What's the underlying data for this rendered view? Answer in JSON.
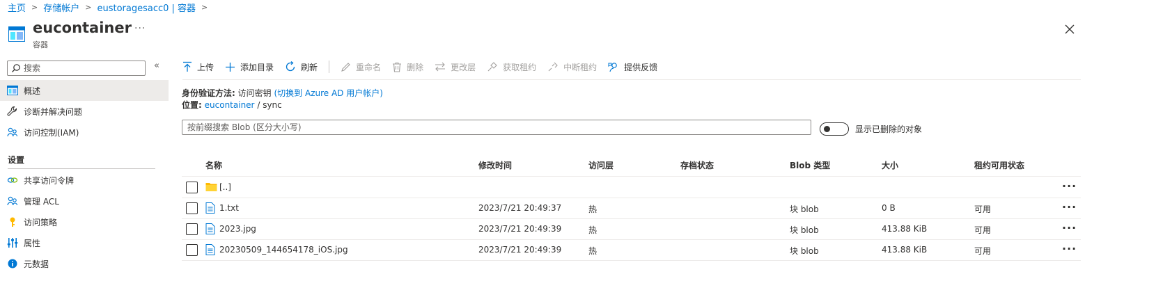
{
  "breadcrumb": [
    "主页",
    "存储帐户",
    "eustoragesacc0 | 容器"
  ],
  "header": {
    "title": "eucontainer",
    "subtitle": "容器",
    "more": "···"
  },
  "sidebar": {
    "search_placeholder": "搜索",
    "collapse_glyph": "«",
    "items": [
      {
        "label": "概述",
        "icon": "container-icon",
        "active": true
      },
      {
        "label": "诊断并解决问题",
        "icon": "wrench-icon"
      },
      {
        "label": "访问控制(IAM)",
        "icon": "people-icon"
      }
    ],
    "section": "设置",
    "settings_items": [
      {
        "label": "共享访问令牌",
        "icon": "link-icon"
      },
      {
        "label": "管理 ACL",
        "icon": "people-icon"
      },
      {
        "label": "访问策略",
        "icon": "key-icon"
      },
      {
        "label": "属性",
        "icon": "sliders-icon"
      },
      {
        "label": "元数据",
        "icon": "info-icon"
      }
    ]
  },
  "toolbar": {
    "upload": "上传",
    "add_directory": "添加目录",
    "refresh": "刷新",
    "rename": "重命名",
    "delete": "删除",
    "change_tier": "更改层",
    "acquire_lease": "获取租约",
    "break_lease": "中断租约",
    "feedback": "提供反馈"
  },
  "auth": {
    "label": "身份验证方法:",
    "value": "访问密钥",
    "switch_link": "(切换到 Azure AD 用户帐户)"
  },
  "location": {
    "label": "位置:",
    "container": "eucontainer",
    "sep": "/",
    "path": "sync"
  },
  "search": {
    "placeholder": "按前缀搜索 Blob (区分大小写)"
  },
  "toggle": {
    "label": "显示已删除的对象"
  },
  "table": {
    "headers": {
      "name": "名称",
      "modified": "修改时间",
      "tier": "访问层",
      "archive": "存档状态",
      "blob_type": "Blob 类型",
      "size": "大小",
      "lease": "租约可用状态"
    },
    "rows": [
      {
        "name": "[..]",
        "icon": "folder-icon",
        "modified": "",
        "tier": "",
        "archive": "",
        "blob_type": "",
        "size": "",
        "lease": ""
      },
      {
        "name": "1.txt",
        "icon": "file-icon",
        "modified": "2023/7/21 20:49:37",
        "tier": "热",
        "archive": "",
        "blob_type": "块 blob",
        "size": "0 B",
        "lease": "可用"
      },
      {
        "name": "2023.jpg",
        "icon": "file-icon",
        "modified": "2023/7/21 20:49:39",
        "tier": "热",
        "archive": "",
        "blob_type": "块 blob",
        "size": "413.88 KiB",
        "lease": "可用"
      },
      {
        "name": "20230509_144654178_iOS.jpg",
        "icon": "file-icon",
        "modified": "2023/7/21 20:49:39",
        "tier": "热",
        "archive": "",
        "blob_type": "块 blob",
        "size": "413.88 KiB",
        "lease": "可用"
      }
    ],
    "row_more": "···"
  }
}
